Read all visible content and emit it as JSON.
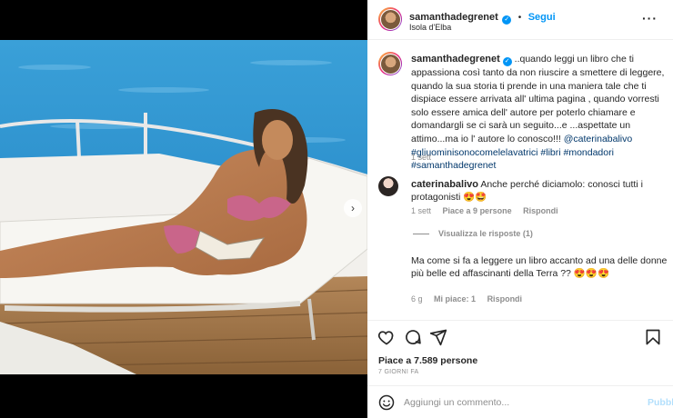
{
  "post_header": {
    "username": "samanthadegrenet",
    "follow_label": "Segui",
    "location": "Isola d'Elba"
  },
  "caption": {
    "username": "samanthadegrenet",
    "text": "..quando leggi un libro che ti appassiona così tanto da non riuscire a smettere di leggere, quando la sua storia ti prende in una maniera tale che ti dispiace essere arrivata all' ultima pagina , quando vorresti solo essere amica dell' autore per poterlo chiamare e domandargli se ci sarà un seguito...e ...aspettate un attimo...ma io l' autore lo conosco!!!",
    "hashtags": "@caterinabalivo #gliuominisonocomelelavatrici #libri #mondadori #samanthadegrenet",
    "time": "1 sett"
  },
  "comment": {
    "username": "caterinabalivo",
    "text": "Anche perché diciamolo: conosci tutti i protagonisti 😍🤩",
    "time": "1 sett",
    "likes": "Piace a 9 persone",
    "reply_label": "Rispondi",
    "view_replies": "Visualizza le risposte (1)"
  },
  "comment2": {
    "text": "Ma come si fa a leggere un libro accanto ad una delle donne più belle ed affascinanti della Terra ?? 😍😍😍",
    "time": "6 g",
    "likes": "Mi piace: 1",
    "reply_label": "Rispondi"
  },
  "post_footer": {
    "likes": "Piace a 7.589 persone",
    "ago": "7 GIORNI FA",
    "comment_placeholder": "Aggiungi un commento...",
    "publish_label": "Pubbli"
  },
  "icons": [
    "heart-icon",
    "comment-icon",
    "share-icon",
    "emoji-icon",
    "more-icon",
    "verified-icon",
    "chevron-right-icon"
  ],
  "colors": {
    "link": "#0095f6",
    "hashtag": "#00376b",
    "muted": "#8e8e8e",
    "text": "#262626"
  }
}
